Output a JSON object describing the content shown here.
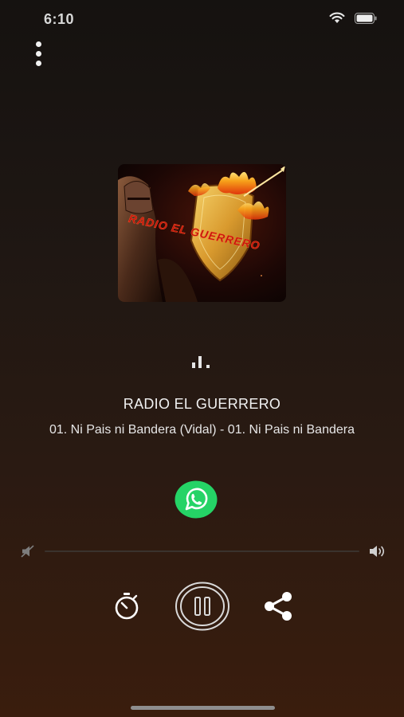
{
  "status_bar": {
    "time": "6:10"
  },
  "station": {
    "name": "RADIO EL GUERRERO"
  },
  "now_playing": {
    "track": "01. Ni Pais ni Bandera (Vidal) - 01. Ni Pais ni Bandera"
  },
  "cover": {
    "logo_text": "RADIO EL GUERRERO"
  },
  "volume": {
    "level": 0
  },
  "icons": {
    "menu": "more-vertical-icon",
    "equalizer": "equalizer-icon",
    "whatsapp": "whatsapp-icon",
    "volume_mute": "volume-mute-icon",
    "volume_max": "volume-max-icon",
    "timer": "stopwatch-icon",
    "play_state": "pause-icon",
    "share": "share-icon"
  },
  "colors": {
    "whatsapp_green": "#25D366",
    "accent_red": "#c2150c",
    "background_top": "#151210",
    "background_bottom": "#3a1d0d"
  }
}
